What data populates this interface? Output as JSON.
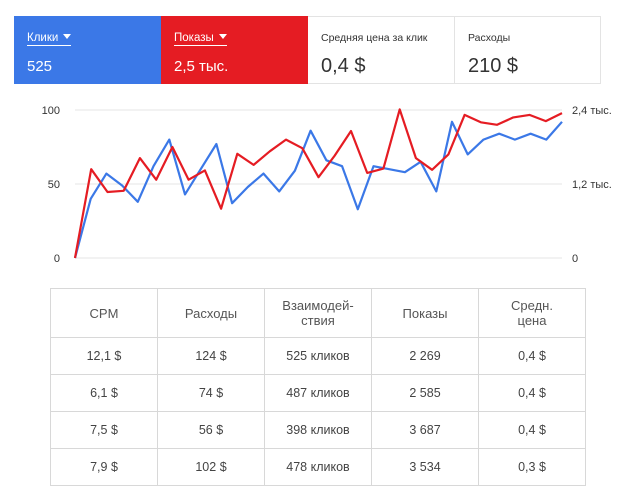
{
  "kpis": [
    {
      "label": "Клики",
      "value": "525",
      "dropdown": true
    },
    {
      "label": "Показы",
      "value": "2,5 тыс.",
      "dropdown": true
    },
    {
      "label": "Средняя цена за клик",
      "value": "0,4 $"
    },
    {
      "label": "Расходы",
      "value": "210 $"
    }
  ],
  "colors": {
    "clicks": "#3b78e7",
    "impressions": "#e51c23",
    "grid": "#e6e6e6"
  },
  "chart_data": {
    "type": "line",
    "left_axis": {
      "ticks": [
        "100",
        "50",
        "0"
      ],
      "values": [
        100,
        50,
        0
      ],
      "ylim": [
        0,
        100
      ]
    },
    "right_axis": {
      "ticks": [
        "2,4 тыс.",
        "1,2 тыс.",
        "0"
      ],
      "values": [
        2400,
        1200,
        0
      ],
      "ylim": [
        0,
        2400
      ]
    },
    "series": [
      {
        "name": "Клики",
        "color": "#3b78e7",
        "axis": "left",
        "values": [
          0,
          40,
          57,
          49,
          38,
          62,
          80,
          43,
          60,
          77,
          37,
          48,
          57,
          45,
          59,
          86,
          66,
          62,
          33,
          62,
          60,
          58,
          65,
          45,
          92,
          70,
          80,
          84,
          80,
          84,
          80,
          92
        ]
      },
      {
        "name": "Показы",
        "color": "#e51c23",
        "axis": "right",
        "values": [
          0,
          1440,
          1070,
          1090,
          1620,
          1270,
          1800,
          1270,
          1420,
          800,
          1690,
          1510,
          1730,
          1920,
          1780,
          1310,
          1660,
          2060,
          1380,
          1450,
          2410,
          1620,
          1430,
          1680,
          2320,
          2200,
          2160,
          2280,
          2320,
          2220,
          2350
        ]
      }
    ]
  },
  "table": {
    "headers": [
      "CPM",
      "Расходы",
      "Взаимодей-\nствия",
      "Показы",
      "Средн.\nцена"
    ],
    "rows": [
      [
        "12,1 $",
        "124 $",
        "525 кликов",
        "2 269",
        "0,4 $"
      ],
      [
        "6,1 $",
        "74 $",
        "487 кликов",
        "2 585",
        "0,4 $"
      ],
      [
        "7,5 $",
        "56 $",
        "398 кликов",
        "3 687",
        "0,4 $"
      ],
      [
        "7,9 $",
        "102 $",
        "478 кликов",
        "3 534",
        "0,3 $"
      ]
    ]
  }
}
